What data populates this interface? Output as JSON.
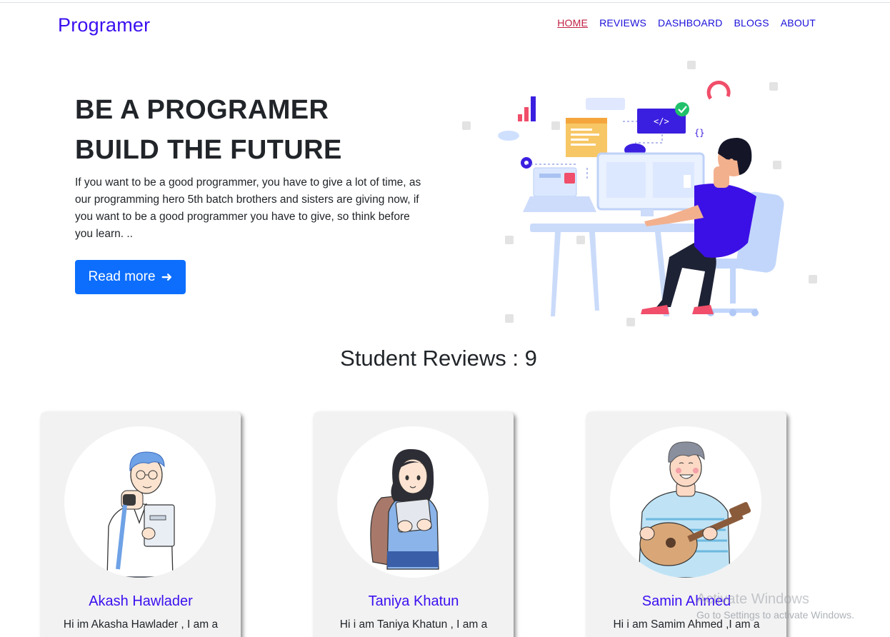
{
  "nav": {
    "brand": "Programer",
    "links": [
      "HOME",
      "REVIEWS",
      "DASHBOARD",
      "BLOGS",
      "ABOUT"
    ]
  },
  "hero": {
    "title_line1": "BE A PROGRAMER",
    "title_line2": "BUILD THE FUTURE",
    "paragraph": "If you want to be a good programmer, you have to give a lot of time, as our programming hero 5th batch brothers and sisters are giving now, if you want to be a good programmer you have to give, so think before you learn. ..",
    "button_label": "Read more",
    "button_arrow": "➜"
  },
  "reviews": {
    "heading": "Student Reviews : 9",
    "cards": [
      {
        "name": "Akash Hawlader",
        "desc": "Hi im Akasha Hawlader , I am a"
      },
      {
        "name": "Taniya Khatun",
        "desc": "Hi i am Taniya Khatun , I am a"
      },
      {
        "name": "Samin Ahmed",
        "desc": "Hi i am Samim Ahmed ,I am a"
      }
    ]
  },
  "os_watermark": {
    "line1": "Activate Windows",
    "line2": "Go to Settings to activate Windows."
  },
  "colors": {
    "brand": "#3b0ff0",
    "nav_link": "#1a10d9",
    "nav_active": "#c01f43",
    "button": "#0d6efd",
    "card_bg": "#f2f2f2"
  }
}
